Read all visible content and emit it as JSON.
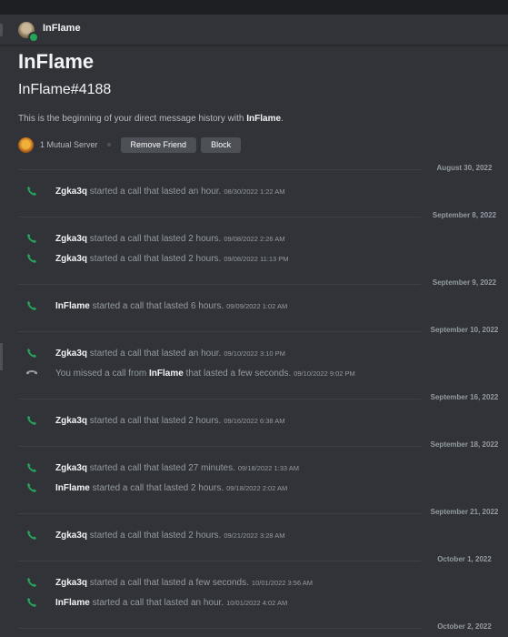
{
  "header": {
    "name": "InFlame"
  },
  "welcome": {
    "title": "InFlame",
    "tag": "InFlame#4188",
    "desc_prefix": "This is the beginning of your direct message history with ",
    "desc_name": "InFlame",
    "desc_suffix": ".",
    "mutual_text": "1 Mutual Server",
    "remove_friend_label": "Remove Friend",
    "block_label": "Block"
  },
  "colors": {
    "accepted_call": "#23a55a",
    "missed_call": "#949ba4",
    "online_status": "#23a55a"
  },
  "dividers": [
    "August 30, 2022",
    "September 8, 2022",
    "September 9, 2022",
    "September 10, 2022",
    "September 16, 2022",
    "September 18, 2022",
    "September 21, 2022",
    "October 1, 2022",
    "October 2, 2022"
  ],
  "calls": [
    {
      "name": "Zgka3q",
      "text": " started a call that lasted an hour.",
      "ts": "08/30/2022 1:22 AM",
      "missed": false,
      "icon": "phone-icon"
    },
    {
      "name": "Zgka3q",
      "text": " started a call that lasted 2 hours.",
      "ts": "09/08/2022 2:26 AM",
      "missed": false,
      "icon": "phone-icon"
    },
    {
      "name": "Zgka3q",
      "text": " started a call that lasted 2 hours.",
      "ts": "09/08/2022 11:13 PM",
      "missed": false,
      "icon": "phone-icon"
    },
    {
      "name": "InFlame",
      "text": " started a call that lasted 6 hours.",
      "ts": "09/09/2022 1:02 AM",
      "missed": false,
      "icon": "phone-icon"
    },
    {
      "name": "Zgka3q",
      "text": " started a call that lasted an hour.",
      "ts": "09/10/2022 3:10 PM",
      "missed": false,
      "icon": "phone-icon"
    },
    {
      "prefix": "You missed a call from ",
      "name": "InFlame",
      "text": " that lasted a few seconds.",
      "ts": "09/10/2022 9:02 PM",
      "missed": true,
      "icon": "missed-call-icon"
    },
    {
      "name": "Zgka3q",
      "text": " started a call that lasted 2 hours.",
      "ts": "09/16/2022 6:38 AM",
      "missed": false,
      "icon": "phone-icon"
    },
    {
      "name": "Zgka3q",
      "text": " started a call that lasted 27 minutes.",
      "ts": "09/18/2022 1:33 AM",
      "missed": false,
      "icon": "phone-icon"
    },
    {
      "name": "InFlame",
      "text": " started a call that lasted 2 hours.",
      "ts": "09/18/2022 2:02 AM",
      "missed": false,
      "icon": "phone-icon"
    },
    {
      "name": "Zgka3q",
      "text": " started a call that lasted 2 hours.",
      "ts": "09/21/2022 3:28 AM",
      "missed": false,
      "icon": "phone-icon"
    },
    {
      "name": "Zgka3q",
      "text": " started a call that lasted a few seconds.",
      "ts": "10/01/2022 3:56 AM",
      "missed": false,
      "icon": "phone-icon"
    },
    {
      "name": "InFlame",
      "text": " started a call that lasted an hour.",
      "ts": "10/01/2022 4:02 AM",
      "missed": false,
      "icon": "phone-icon"
    }
  ]
}
